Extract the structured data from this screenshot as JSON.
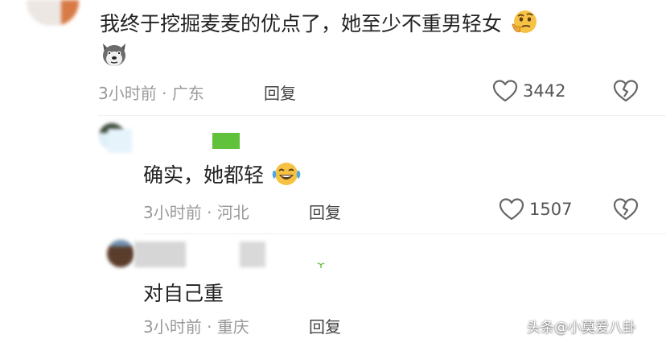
{
  "comments": [
    {
      "text_line1": "我终于挖掘麦麦的优点了，她至少不重男轻女",
      "time": "3小时前",
      "separator": "·",
      "location": "广东",
      "reply_label": "回复",
      "likes": "3442",
      "emojis": [
        "thinking-face-emoji",
        "dog-face-emoji"
      ]
    },
    {
      "text": "确实，她都轻",
      "time": "3小时前",
      "separator": "·",
      "location": "河北",
      "reply_label": "回复",
      "likes": "1507",
      "emojis": [
        "laughing-tears-emoji"
      ]
    },
    {
      "text": "对自己重",
      "time": "3小时前",
      "separator": "·",
      "location": "重庆",
      "reply_label": "回复"
    }
  ],
  "watermark": {
    "text": "头条@小莫爱八卦"
  },
  "colors": {
    "meta_gray": "#9a9a9a",
    "text_dark": "#222222",
    "icon_gray": "#666666"
  }
}
